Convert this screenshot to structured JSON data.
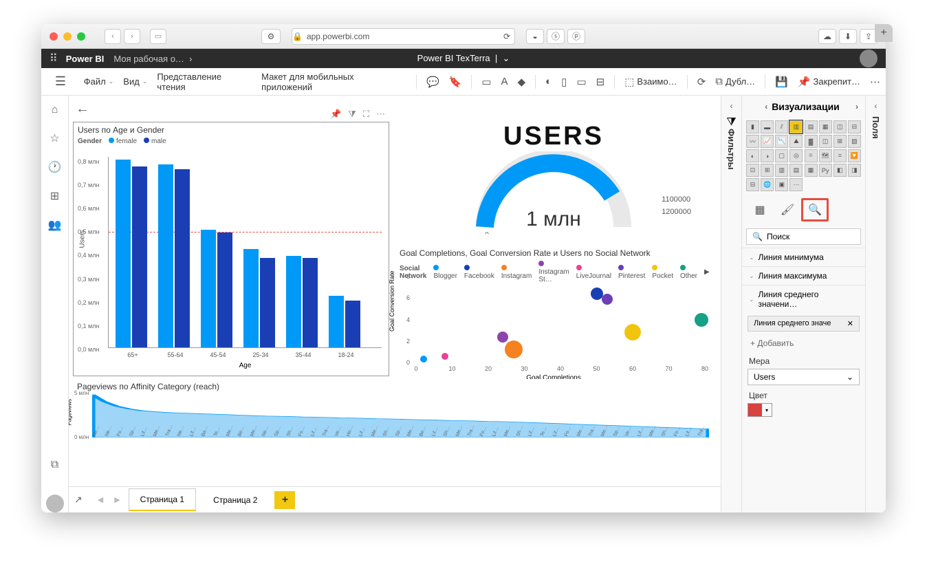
{
  "browser": {
    "url": "app.powerbi.com"
  },
  "header": {
    "brand": "Power BI",
    "breadcrumb": "Моя рабочая о…",
    "title": "Power BI TexTerra"
  },
  "ribbon": {
    "file": "Файл",
    "view": "Вид",
    "reading_view": "Представление чтения",
    "mobile_layout": "Макет для мобильных приложений",
    "interact": "Взаимо…",
    "duplicate": "Дубл…",
    "pin": "Закрепит…"
  },
  "pages": {
    "page1": "Страница 1",
    "page2": "Страница 2"
  },
  "filters_panel": "Фильтры",
  "fields_panel": "Поля",
  "viz_panel": {
    "title": "Визуализации",
    "search": "Поиск",
    "line_min": "Линия минимума",
    "line_max": "Линия максимума",
    "line_avg": "Линия среднего значени…",
    "chip_avg": "Линия среднего значе",
    "add": "Добавить",
    "measure_label": "Мера",
    "measure_value": "Users",
    "color_label": "Цвет"
  },
  "chart_data": [
    {
      "type": "bar",
      "title": "Users по Age и Gender",
      "legend_label": "Gender",
      "series_names": [
        "female",
        "male"
      ],
      "series_colors": [
        "#0099f7",
        "#1a3fb5"
      ],
      "categories": [
        "65+",
        "55-64",
        "45-54",
        "25-34",
        "35-44",
        "18-24"
      ],
      "series": [
        {
          "name": "female",
          "values": [
            0.8,
            0.78,
            0.5,
            0.42,
            0.39,
            0.22
          ]
        },
        {
          "name": "male",
          "values": [
            0.77,
            0.76,
            0.49,
            0.38,
            0.38,
            0.2
          ]
        }
      ],
      "ylabel": "Users",
      "xlabel": "Age",
      "y_ticks": [
        "0,0 млн",
        "0,1 млн",
        "0,2 млн",
        "0,3 млн",
        "0,4 млн",
        "0,5 млн",
        "0,6 млн",
        "0,7 млн",
        "0,8 млн"
      ],
      "ylim": [
        0,
        0.82
      ],
      "reference_line": 0.5,
      "unit": "млн"
    },
    {
      "type": "gauge",
      "title": "USERS",
      "value_display": "1 млн",
      "min": 0,
      "value": 1000000,
      "target": 1100000,
      "max": 1200000,
      "fill_fraction": 0.83
    },
    {
      "type": "scatter",
      "title": "Goal Completions, Goal Conversion Rate и Users по Social Network",
      "legend_label": "Social Network",
      "xlabel": "Goal Completions",
      "ylabel": "Goal Conversion Rate",
      "x_ticks": [
        0,
        10,
        20,
        30,
        40,
        50,
        60,
        70,
        80
      ],
      "y_ticks": [
        0,
        2,
        4,
        6,
        8
      ],
      "xlim": [
        0,
        80
      ],
      "ylim": [
        0,
        8
      ],
      "series": [
        {
          "name": "Blogger",
          "color": "#0099f7",
          "x": 2,
          "y": 0.3,
          "r": 5
        },
        {
          "name": "Facebook",
          "color": "#1a3fb5",
          "x": 50,
          "y": 6.4,
          "r": 9
        },
        {
          "name": "Instagram",
          "color": "#f58220",
          "x": 27,
          "y": 1.2,
          "r": 13
        },
        {
          "name": "Instagram St…",
          "color": "#8e44ad",
          "x": 24,
          "y": 2.4,
          "r": 8
        },
        {
          "name": "LiveJournal",
          "color": "#e84393",
          "x": 8,
          "y": 0.6,
          "r": 5
        },
        {
          "name": "Pinterest",
          "color": "#6c3fb5",
          "x": 53,
          "y": 5.9,
          "r": 8
        },
        {
          "name": "Pocket",
          "color": "#f1c40f",
          "x": 60,
          "y": 2.8,
          "r": 12
        },
        {
          "name": "Other",
          "color": "#16a085",
          "x": 79,
          "y": 4.0,
          "r": 10
        }
      ]
    },
    {
      "type": "area",
      "title": "Pageviews по Affinity Category (reach)",
      "ylabel": "Pageviews",
      "y_ticks": [
        "0 млн",
        "5 млн"
      ],
      "ylim": [
        0,
        5
      ],
      "categories": [
        "New…",
        "New…",
        "Foo…",
        "Spor…",
        "Lifes…",
        "Med…",
        "Trav…",
        "New…",
        "Lifes…",
        "Ban…",
        "Tech…",
        "Med…",
        "Bea…",
        "Med…",
        "New…",
        "Spor…",
        "Sho…",
        "Foo…",
        "Lifes…",
        "Trav…",
        "Veh…",
        "Ho…",
        "Lifes…",
        "Med…",
        "Sho…",
        "Spor…",
        "Med…",
        "Bea…",
        "Lifes…",
        "Sho…",
        "Med…",
        "Trav…",
        "Foo…",
        "Lifes…",
        "Med…",
        "Sho…",
        "Lifes…",
        "Tech…",
        "Lifes…",
        "Foo…",
        "Med…",
        "Trav…",
        "Med…",
        "Spor…",
        "Veh…",
        "Lifes…",
        "Med…",
        "Sho…",
        "Foo…",
        "Lifes…",
        "Trav…"
      ],
      "values": [
        4.8,
        4.0,
        3.5,
        3.2,
        3.0,
        2.9,
        2.8,
        2.75,
        2.7,
        2.65,
        2.6,
        2.55,
        2.5,
        2.45,
        2.4,
        2.38,
        2.35,
        2.3,
        2.28,
        2.25,
        2.2,
        2.18,
        2.15,
        2.1,
        2.08,
        2.05,
        2.0,
        1.98,
        1.95,
        1.9,
        1.88,
        1.85,
        1.8,
        1.78,
        1.75,
        1.7,
        1.65,
        1.6,
        1.55,
        1.5,
        1.45,
        1.4,
        1.35,
        1.3,
        1.25,
        1.2,
        1.15,
        1.1,
        1.05,
        1.0,
        0.95
      ]
    }
  ]
}
